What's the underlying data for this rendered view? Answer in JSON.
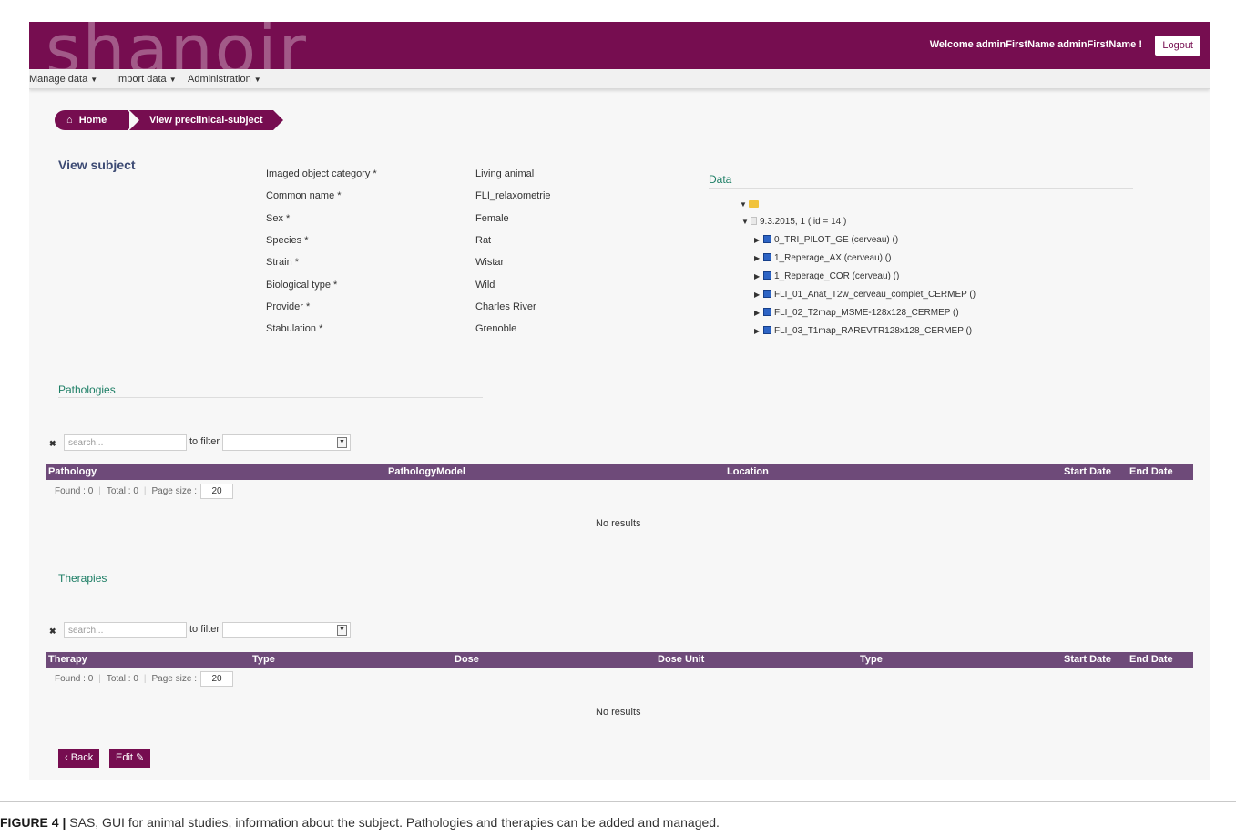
{
  "header": {
    "logo": "shanoir",
    "welcome": "Welcome adminFirstName adminFirstName !",
    "logout_label": "Logout"
  },
  "nav": [
    {
      "label": "Manage data"
    },
    {
      "label": "Import data"
    },
    {
      "label": "Administration"
    }
  ],
  "breadcrumb": {
    "home": "Home",
    "current": "View preclinical-subject"
  },
  "subject": {
    "title": "View subject",
    "fields": [
      {
        "label": "Imaged object category *",
        "value": "Living animal"
      },
      {
        "label": "Common name *",
        "value": "FLI_relaxometrie"
      },
      {
        "label": "Sex *",
        "value": "Female"
      },
      {
        "label": "Species *",
        "value": "Rat"
      },
      {
        "label": "Strain *",
        "value": "Wistar"
      },
      {
        "label": "Biological type *",
        "value": "Wild"
      },
      {
        "label": "Provider *",
        "value": "Charles River"
      },
      {
        "label": "Stabulation *",
        "value": "Grenoble"
      }
    ]
  },
  "data_tree": {
    "title": "Data",
    "exam": "9.3.2015, 1 ( id = 14 )",
    "items": [
      "0_TRI_PILOT_GE (cerveau) ()",
      "1_Reperage_AX (cerveau) ()",
      "1_Reperage_COR (cerveau) ()",
      "FLI_01_Anat_T2w_cerveau_complet_CERMEP ()",
      "FLI_02_T2map_MSME-128x128_CERMEP ()",
      "FLI_03_T1map_RAREVTR128x128_CERMEP ()"
    ]
  },
  "pathologies": {
    "title": "Pathologies",
    "search_placeholder": "search...",
    "filter_label": "to filter",
    "columns": [
      "Pathology",
      "PathologyModel",
      "Location",
      "Start Date",
      "End Date"
    ],
    "found": "Found : 0",
    "total": "Total : 0",
    "page_size_label": "Page size :",
    "page_size": "20",
    "no_results": "No results"
  },
  "therapies": {
    "title": "Therapies",
    "search_placeholder": "search...",
    "filter_label": "to filter",
    "columns": [
      "Therapy",
      "Type",
      "Dose",
      "Dose Unit",
      "Type",
      "Start Date",
      "End Date"
    ],
    "found": "Found : 0",
    "total": "Total : 0",
    "page_size_label": "Page size :",
    "page_size": "20",
    "no_results": "No results"
  },
  "actions": {
    "back": "Back",
    "edit": "Edit"
  },
  "caption": {
    "label": "FIGURE 4 |",
    "text": " SAS, GUI for animal studies, information about the subject. Pathologies and therapies can be added and managed."
  },
  "colors": {
    "brand": "#760d50",
    "table_header": "#6e4a79",
    "section_title": "#1d7e65"
  }
}
